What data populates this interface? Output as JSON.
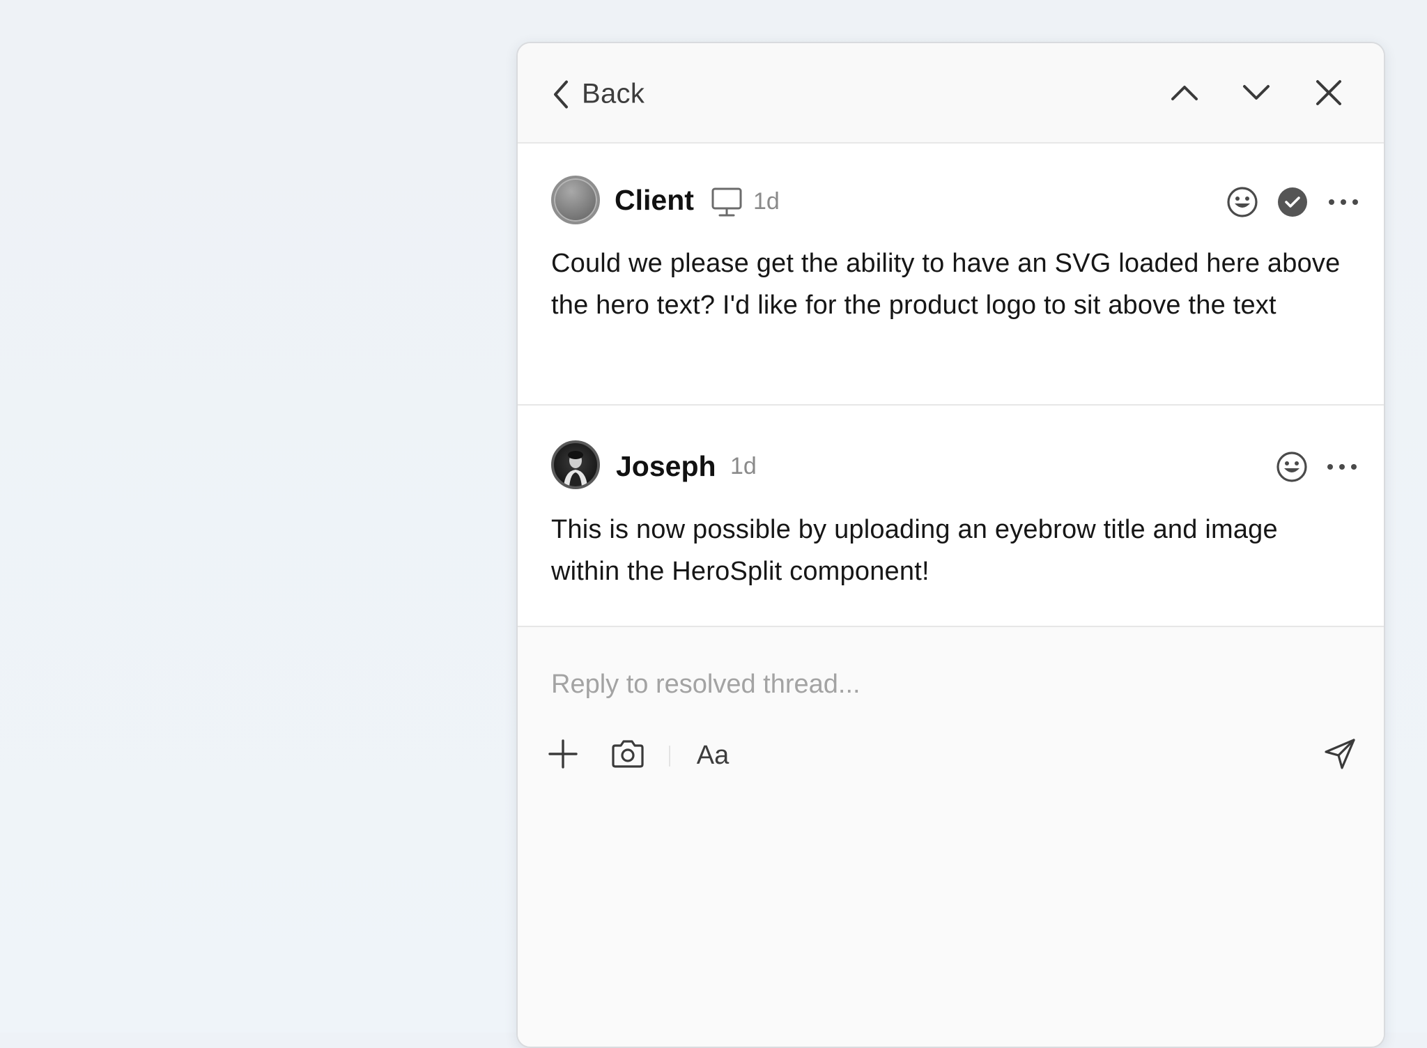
{
  "header": {
    "back_label": "Back",
    "prev_icon": "chevron-up-icon",
    "next_icon": "chevron-down-icon",
    "close_icon": "close-icon"
  },
  "comments": [
    {
      "author": "Client",
      "device_icon": "monitor-icon",
      "time": "1d",
      "text": "Could we please get the ability to have an SVG loaded here above the hero text? I'd like for the product logo to sit above the text",
      "resolved": true
    },
    {
      "author": "Joseph",
      "time": "1d",
      "text": "This is now possible by uploading an eyebrow title and image within the HeroSplit component!"
    }
  ],
  "composer": {
    "placeholder": "Reply to resolved thread...",
    "value": "",
    "format_label": "Aa"
  },
  "colors": {
    "background": "#eef2f7",
    "panel": "#fafafa",
    "resolved_badge": "#555555"
  }
}
